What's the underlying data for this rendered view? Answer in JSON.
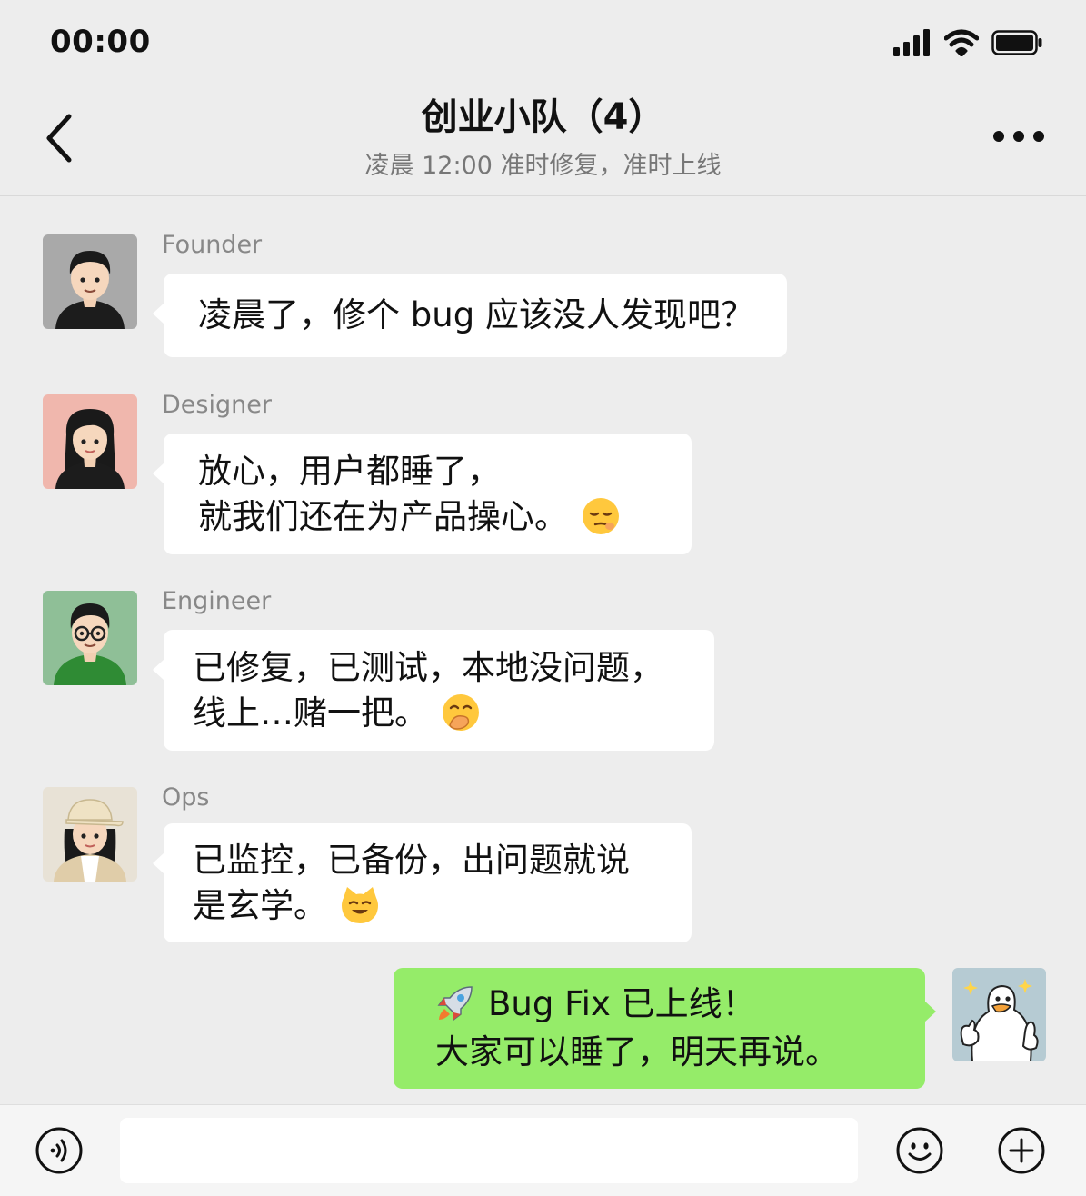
{
  "status": {
    "time": "00:00"
  },
  "header": {
    "title": "创业小队（4）",
    "subtitle": "凌晨 12:00 准时修复，准时上线"
  },
  "messages": [
    {
      "sender": "Founder",
      "line1": "凌晨了，修个 bug 应该没人发现吧？"
    },
    {
      "sender": "Designer",
      "line1": "放心，用户都睡了，",
      "line2": "就我们还在为产品操心。",
      "emoji": "relieved-face-icon"
    },
    {
      "sender": "Engineer",
      "line1": "已修复，已测试，本地没问题，",
      "line2": "线上…赌一把。",
      "emoji": "face-with-hand-over-mouth-icon"
    },
    {
      "sender": "Ops",
      "line1": "已监控，已备份，出问题就说",
      "line2": "是玄学。",
      "emoji": "grinning-cat-icon"
    }
  ],
  "my_message": {
    "line1": "Bug Fix 已上线！",
    "line2": "大家可以睡了，明天再说。",
    "emoji": "rocket-icon",
    "avatar": "duck-thumbs-up-icon"
  },
  "colors": {
    "background": "#ededed",
    "my_bubble": "#95ec69",
    "other_bubble": "#ffffff"
  }
}
